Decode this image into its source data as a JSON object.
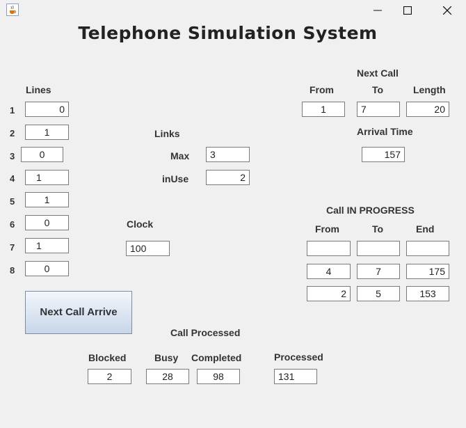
{
  "window": {
    "title": "Telephone Simulation System"
  },
  "lines": {
    "label": "Lines",
    "items": [
      {
        "n": "1",
        "value": "0"
      },
      {
        "n": "2",
        "value": "1"
      },
      {
        "n": "3",
        "value": "0"
      },
      {
        "n": "4",
        "value": "1"
      },
      {
        "n": "5",
        "value": "1"
      },
      {
        "n": "6",
        "value": "0"
      },
      {
        "n": "7",
        "value": "1"
      },
      {
        "n": "8",
        "value": "0"
      }
    ]
  },
  "links": {
    "label": "Links",
    "max_label": "Max",
    "max_value": "3",
    "inuse_label": "inUse",
    "inuse_value": "2"
  },
  "clock": {
    "label": "Clock",
    "value": "100"
  },
  "next_call": {
    "label": "Next Call",
    "from_label": "From",
    "to_label": "To",
    "length_label": "Length",
    "from": "1",
    "to": "7",
    "length": "20",
    "arrival_label": "Arrival Time",
    "arrival": "157"
  },
  "in_progress": {
    "label": "Call IN PROGRESS",
    "from_label": "From",
    "to_label": "To",
    "end_label": "End",
    "rows": [
      {
        "from": "",
        "to": "",
        "end": ""
      },
      {
        "from": "4",
        "to": "7",
        "end": "175"
      },
      {
        "from": "2",
        "to": "5",
        "end": "153"
      }
    ]
  },
  "button": {
    "label": "Next Call Arrive"
  },
  "processed": {
    "label": "Call Processed",
    "blocked_label": "Blocked",
    "busy_label": "Busy",
    "completed_label": "Completed",
    "processed_label": "Processed",
    "blocked": "2",
    "busy": "28",
    "completed": "98",
    "processed": "131"
  },
  "icons": {
    "app": "java-cup-icon",
    "minimize": "minimize-icon",
    "maximize": "maximize-icon",
    "close": "close-icon"
  }
}
